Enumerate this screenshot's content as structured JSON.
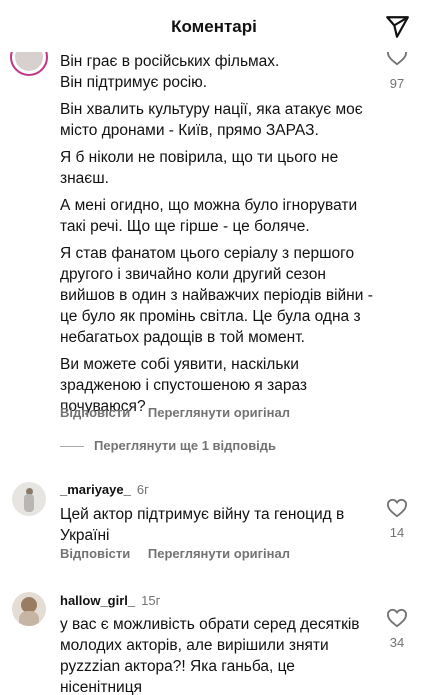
{
  "header": {
    "title": "Коментарі"
  },
  "comment1": {
    "paragraphs": [
      "Він грає в російських фільмах.",
      "Він підтримує росію.",
      "Він хвалить культуру нації, яка атакує моє місто дронами - Київ, прямо ЗАРАЗ.",
      "Я б ніколи не повірила, що ти цього не знаєш.",
      "А мені огидно, що можна було ігнорувати такі речі. Що ще гірше - це боляче.",
      "Я став фанатом цього серіалу з першого другого і звичайно коли другий сезон вийшов в один з найважчих періодів війни - це було як промінь світла. Це була одна з небагатьох радощів в той момент.",
      "Ви можете собі уявити, наскільки зрадженою і спустошеною я зараз почуваюся?"
    ],
    "reply": "Відповісти",
    "see_original": "Переглянути оригінал",
    "likes": "97",
    "more_replies": "Переглянути ще 1 відповідь"
  },
  "comment2": {
    "username": "_mariyaye_",
    "time": "6г",
    "text": "Цей актор підтримує війну та геноцид в Україні",
    "reply": "Відповісти",
    "see_original": "Переглянути оригінал",
    "likes": "14"
  },
  "comment3": {
    "username": "hallow_girl_",
    "time": "15г",
    "text": "у вас є можливість обрати серед десятків молодих акторів, але вирішили зняти руzzzian актора?! Яка ганьба, це нісенітниця",
    "likes": "34"
  },
  "colors": {
    "text": "#111111",
    "muted": "#737373",
    "divider": "#a8a8a8"
  },
  "icons": {
    "share": "paper-plane-icon",
    "like": "heart-outline-icon"
  }
}
